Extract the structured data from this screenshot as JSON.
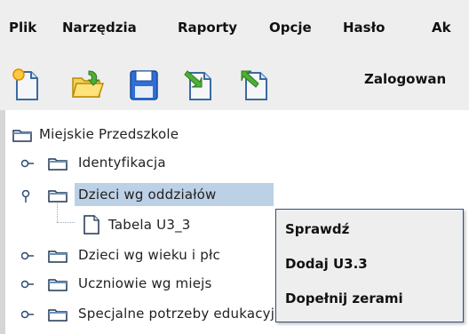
{
  "menubar": {
    "items": [
      "Plik",
      "Narzędzia",
      "Raporty",
      "Opcje",
      "Hasło",
      "Ak"
    ]
  },
  "toolbar": {
    "buttons": [
      "new-document-icon",
      "open-folder-icon",
      "save-icon",
      "import-icon",
      "export-icon"
    ],
    "logged_label": "Zalogowan"
  },
  "tree": {
    "root": "Miejskie Przedszkole",
    "items": [
      {
        "label": "Identyfikacja",
        "expanded": false
      },
      {
        "label": "Dzieci wg oddziałów",
        "expanded": true,
        "selected": true
      },
      {
        "label": "Tabela U3_3",
        "leaf": true
      },
      {
        "label": "Dzieci wg wieku i płc",
        "expanded": false
      },
      {
        "label": "Uczniowie wg miejs",
        "expanded": false
      },
      {
        "label": "Specjalne potrzeby edukacyjne dzieci",
        "expanded": false
      }
    ]
  },
  "context_menu": {
    "items": [
      "Sprawdź",
      "Dodaj U3.3",
      "Dopełnij zerami"
    ]
  },
  "colors": {
    "selection": "#bcd0e6",
    "menu_border": "#2f4f7f",
    "chrome_bg": "#eeeeee"
  }
}
